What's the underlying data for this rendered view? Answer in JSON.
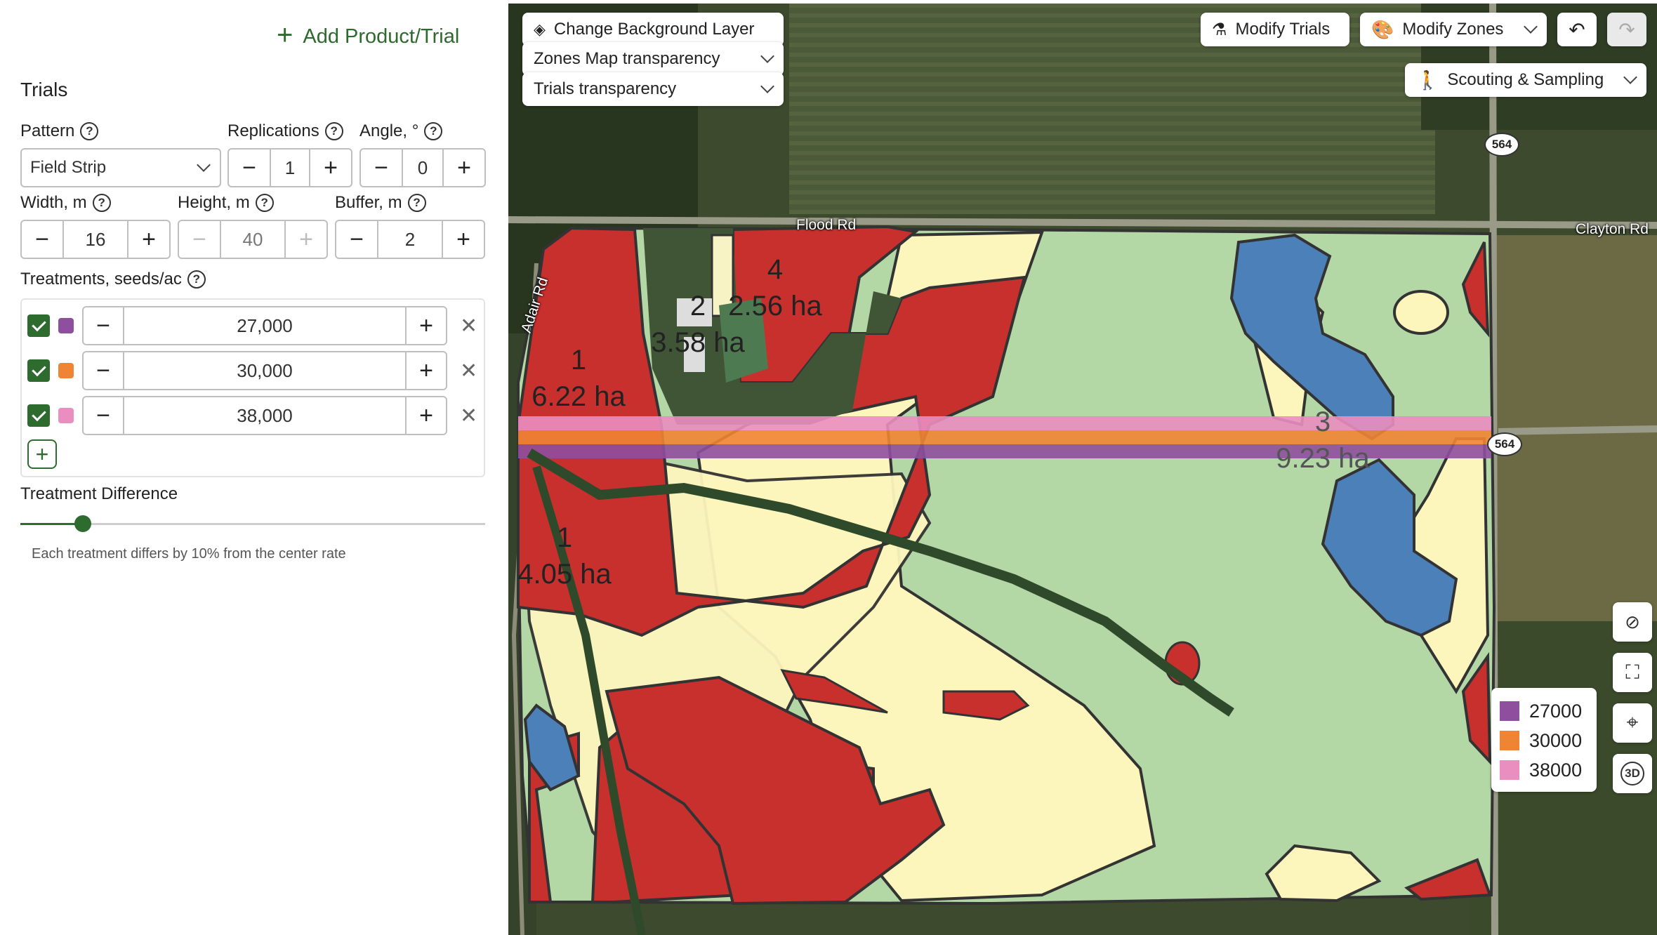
{
  "panel": {
    "add_label": "Add Product/Trial",
    "section_title": "Trials",
    "pattern_label": "Pattern",
    "pattern_value": "Field Strip",
    "replications_label": "Replications",
    "replications_value": "1",
    "angle_label": "Angle, °",
    "angle_value": "0",
    "width_label": "Width, m",
    "width_value": "16",
    "height_label": "Height, m",
    "height_value": "40",
    "buffer_label": "Buffer, m",
    "buffer_value": "2",
    "treatments_label": "Treatments, seeds/ac",
    "treatments": [
      {
        "value": "27,000",
        "color": "#8e4f9e"
      },
      {
        "value": "30,000",
        "color": "#ef8534"
      },
      {
        "value": "38,000",
        "color": "#ea8ec0"
      }
    ],
    "difference_label": "Treatment Difference",
    "difference_level_fraction": 0.2,
    "difference_hint": "Each treatment differs by 10% from the center rate"
  },
  "map": {
    "bg_layer_label": "Change Background Layer",
    "zones_transparency_label": "Zones Map transparency",
    "trials_transparency_label": "Trials transparency",
    "modify_trials_label": "Modify Trials",
    "modify_zones_label": "Modify Zones",
    "scouting_label": "Scouting & Sampling",
    "roads": {
      "flood": "Flood Rd",
      "clayton": "Clayton Rd",
      "adair": "Adair Rd",
      "route_a": "564",
      "route_b": "564"
    },
    "zones": [
      {
        "id": "1",
        "area": "6.22 ha"
      },
      {
        "id": "2",
        "area": "3.58 ha"
      },
      {
        "id": "4",
        "area": "2.56 ha"
      },
      {
        "id": "3",
        "area": "9.23 ha"
      },
      {
        "id": "1",
        "area": "4.05 ha"
      }
    ],
    "legend": [
      {
        "value": "27000",
        "color": "#8e4f9e"
      },
      {
        "value": "30000",
        "color": "#ef8534"
      },
      {
        "value": "38000",
        "color": "#ea8ec0"
      }
    ],
    "colors": {
      "zone1": "#c8302e",
      "zone2": "#fcf6bd",
      "zone3": "#b3d7a5",
      "zone4": "#4b80b8"
    }
  }
}
